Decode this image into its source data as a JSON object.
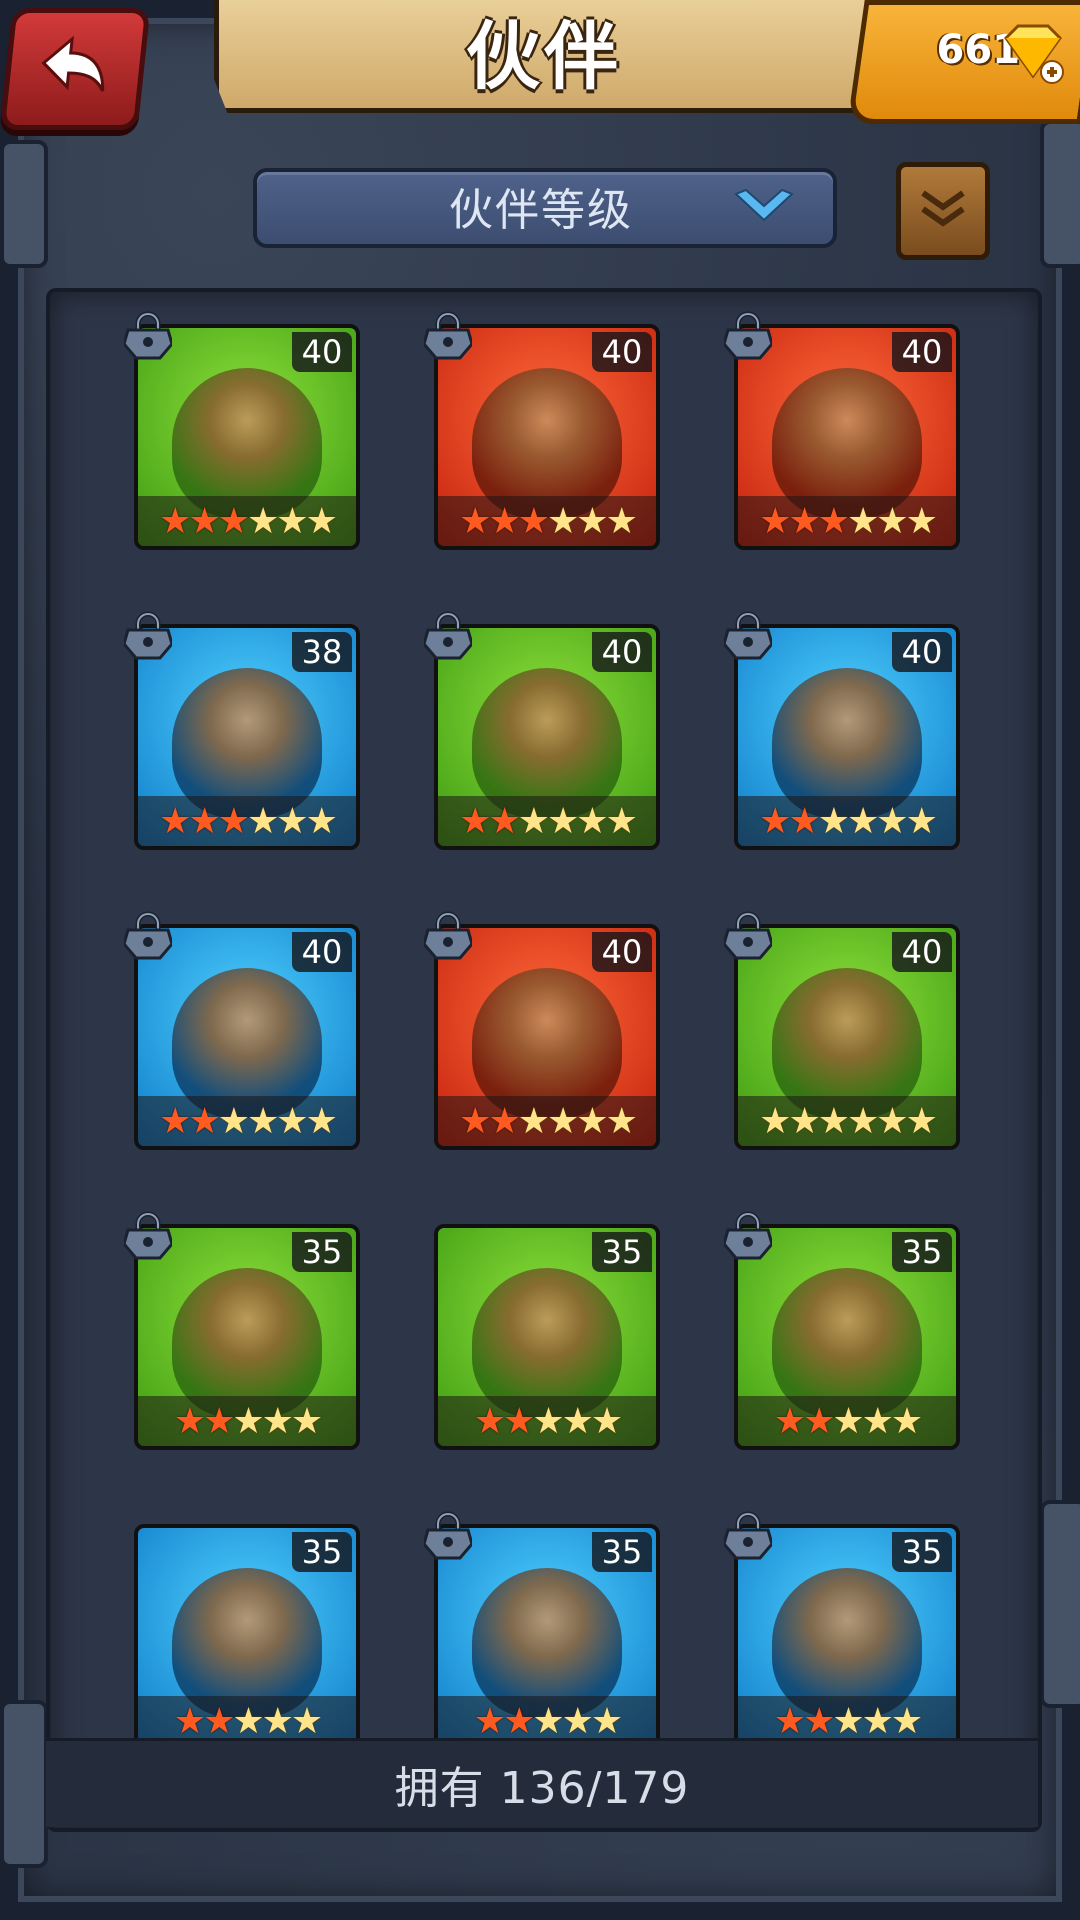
{
  "header": {
    "title": "伙伴",
    "gems": "661",
    "back_icon": "back-arrow-icon",
    "gem_icon": "diamond-plus-icon"
  },
  "sort": {
    "label": "伙伴等级",
    "icon": "chevron-down-icon",
    "scroll_icon": "scroll-icon"
  },
  "partners": [
    {
      "level": "40",
      "bg": "green",
      "red_stars": 3,
      "total_stars": 6,
      "locked": true
    },
    {
      "level": "40",
      "bg": "red",
      "red_stars": 3,
      "total_stars": 6,
      "locked": true
    },
    {
      "level": "40",
      "bg": "red",
      "red_stars": 3,
      "total_stars": 6,
      "locked": true
    },
    {
      "level": "38",
      "bg": "blue",
      "red_stars": 3,
      "total_stars": 6,
      "locked": true
    },
    {
      "level": "40",
      "bg": "green",
      "red_stars": 2,
      "total_stars": 6,
      "locked": true
    },
    {
      "level": "40",
      "bg": "blue",
      "red_stars": 2,
      "total_stars": 6,
      "locked": true
    },
    {
      "level": "40",
      "bg": "blue",
      "red_stars": 2,
      "total_stars": 6,
      "locked": true
    },
    {
      "level": "40",
      "bg": "red",
      "red_stars": 2,
      "total_stars": 6,
      "locked": true
    },
    {
      "level": "40",
      "bg": "green",
      "red_stars": 0,
      "total_stars": 6,
      "locked": true
    },
    {
      "level": "35",
      "bg": "green",
      "red_stars": 2,
      "total_stars": 5,
      "locked": true
    },
    {
      "level": "35",
      "bg": "green",
      "red_stars": 2,
      "total_stars": 5,
      "locked": false
    },
    {
      "level": "35",
      "bg": "green",
      "red_stars": 2,
      "total_stars": 5,
      "locked": true
    },
    {
      "level": "35",
      "bg": "blue",
      "red_stars": 2,
      "total_stars": 5,
      "locked": false
    },
    {
      "level": "35",
      "bg": "blue",
      "red_stars": 2,
      "total_stars": 5,
      "locked": true
    },
    {
      "level": "35",
      "bg": "blue",
      "red_stars": 2,
      "total_stars": 5,
      "locked": true
    }
  ],
  "footer": {
    "owned_text": "拥有 136/179"
  },
  "colors": {
    "frame": "#2b3546",
    "banner": "#e0bf80",
    "gem_panel": "#f0a020",
    "back_button": "#c02a2a"
  }
}
